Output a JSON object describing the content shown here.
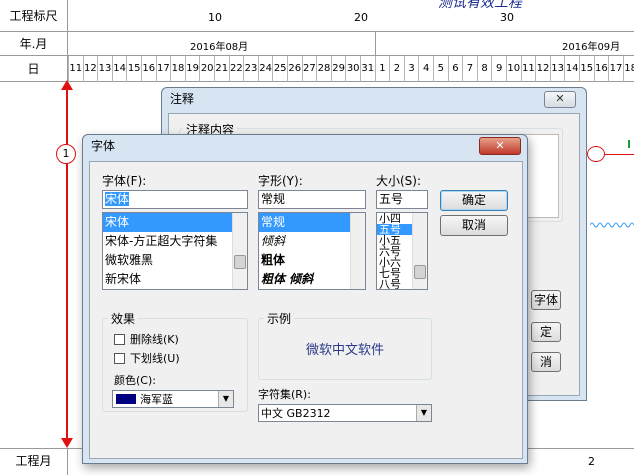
{
  "ruler": {
    "row1_label": "工程标尺",
    "row2_label": "年.月",
    "row3_label": "日",
    "ticks": [
      "10",
      "20",
      "30"
    ],
    "months": [
      "2016年08月",
      "2016年09月"
    ],
    "days": [
      "11",
      "12",
      "13",
      "14",
      "15",
      "16",
      "17",
      "18",
      "19",
      "20",
      "21",
      "22",
      "23",
      "24",
      "25",
      "26",
      "27",
      "28",
      "29",
      "30",
      "31",
      "1",
      "2",
      "3",
      "4",
      "5",
      "6",
      "7",
      "8",
      "9",
      "10",
      "11",
      "12",
      "13",
      "14",
      "15",
      "16",
      "17",
      "18"
    ],
    "top_text": "测试有效工程"
  },
  "bottom": {
    "label": "工程月",
    "value": "2"
  },
  "node": {
    "label": "1"
  },
  "note_dialog": {
    "title": "注释",
    "group_label": "注释内容",
    "font_button": "字体",
    "ok_button": "定",
    "cancel_button": "消"
  },
  "font_dialog": {
    "title": "字体",
    "font_label": "字体(F):",
    "font_value": "宋体",
    "font_items": [
      "宋体",
      "宋体-方正超大字符集",
      "微软雅黑",
      "新宋体"
    ],
    "style_label": "字形(Y):",
    "style_value": "常规",
    "style_items": [
      "常规",
      "倾斜",
      "粗体",
      "粗体 倾斜"
    ],
    "size_label": "大小(S):",
    "size_value": "五号",
    "size_items": [
      "小四",
      "五号",
      "小五",
      "六号",
      "小六",
      "七号",
      "八号"
    ],
    "ok_button": "确定",
    "cancel_button": "取消",
    "effects_label": "效果",
    "strike_label": "删除线(K)",
    "underline_label": "下划线(U)",
    "color_label": "颜色(C):",
    "color_value": "海军蓝",
    "color_swatch": "#000080",
    "sample_label": "示例",
    "sample_text": "微软中文软件",
    "script_label": "字符集(R):",
    "script_value": "中文 GB2312"
  },
  "colors": {
    "red_line": "#e01010",
    "accent_green": "#1a9a3a",
    "wave": "#3aa0ff",
    "sample_text": "#2a3a8a",
    "title_text": "#1b2e8f"
  }
}
